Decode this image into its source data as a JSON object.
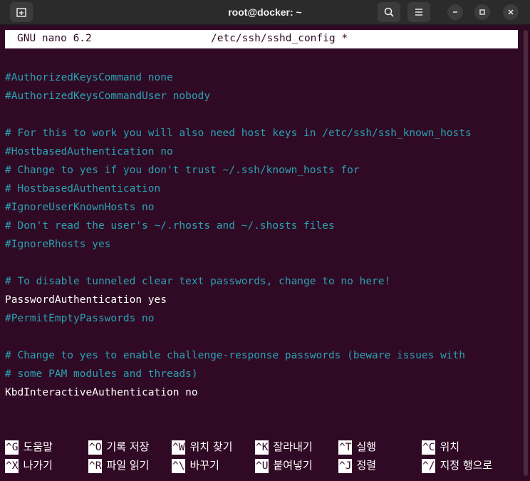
{
  "window": {
    "title": "root@docker: ~",
    "icons": {
      "new_tab": "new-tab-icon",
      "search": "search-icon",
      "menu": "hamburger-menu-icon",
      "minimize": "minimize-icon",
      "maximize": "maximize-icon",
      "close": "close-icon"
    }
  },
  "nano": {
    "version": "GNU nano 6.2",
    "filename": "/etc/ssh/sshd_config *"
  },
  "lines": [
    {
      "text": "#AuthorizedKeysCommand none",
      "comment": true
    },
    {
      "text": "#AuthorizedKeysCommandUser nobody",
      "comment": true
    },
    {
      "text": "",
      "comment": true
    },
    {
      "text": "# For this to work you will also need host keys in /etc/ssh/ssh_known_hosts",
      "comment": true
    },
    {
      "text": "#HostbasedAuthentication no",
      "comment": true
    },
    {
      "text": "# Change to yes if you don't trust ~/.ssh/known_hosts for",
      "comment": true
    },
    {
      "text": "# HostbasedAuthentication",
      "comment": true
    },
    {
      "text": "#IgnoreUserKnownHosts no",
      "comment": true
    },
    {
      "text": "# Don't read the user's ~/.rhosts and ~/.shosts files",
      "comment": true
    },
    {
      "text": "#IgnoreRhosts yes",
      "comment": true
    },
    {
      "text": "",
      "comment": true
    },
    {
      "text": "# To disable tunneled clear text passwords, change to no here!",
      "comment": true
    },
    {
      "text": "PasswordAuthentication yes",
      "comment": false
    },
    {
      "text": "#PermitEmptyPasswords no",
      "comment": true
    },
    {
      "text": "",
      "comment": true
    },
    {
      "text": "# Change to yes to enable challenge-response passwords (beware issues with",
      "comment": true
    },
    {
      "text": "# some PAM modules and threads)",
      "comment": true
    },
    {
      "text": "KbdInteractiveAuthentication no",
      "comment": false
    }
  ],
  "shortcuts": [
    {
      "key": "^G",
      "label": "도움말"
    },
    {
      "key": "^O",
      "label": "기록 저장"
    },
    {
      "key": "^W",
      "label": "위치 찾기"
    },
    {
      "key": "^K",
      "label": "잘라내기"
    },
    {
      "key": "^T",
      "label": "실행"
    },
    {
      "key": "^C",
      "label": "위치"
    },
    {
      "key": "^X",
      "label": "나가기"
    },
    {
      "key": "^R",
      "label": "파일 읽기"
    },
    {
      "key": "^\\",
      "label": "바꾸기"
    },
    {
      "key": "^U",
      "label": "붙여넣기"
    },
    {
      "key": "^J",
      "label": "정렬"
    },
    {
      "key": "^/",
      "label": "지정 행으로"
    }
  ],
  "colors": {
    "terminal_bg": "#300a24",
    "comment": "#2aa1b3",
    "text": "#ffffff",
    "titlebar": "#2b2b2b"
  }
}
